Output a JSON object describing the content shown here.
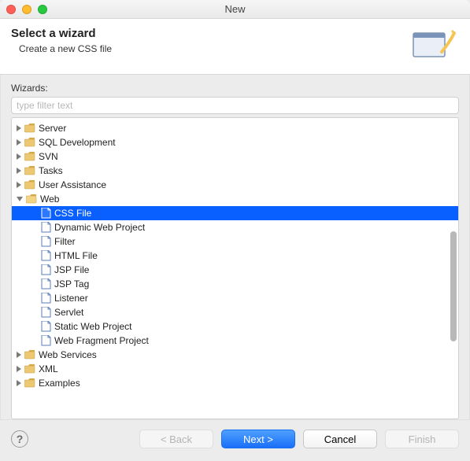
{
  "window": {
    "title": "New"
  },
  "header": {
    "title": "Select a wizard",
    "subtitle": "Create a new CSS file"
  },
  "wizards": {
    "label": "Wizards:",
    "filter_placeholder": "type filter text"
  },
  "tree": {
    "items": [
      {
        "label": "Server",
        "type": "folder",
        "state": "closed",
        "depth": 0
      },
      {
        "label": "SQL Development",
        "type": "folder",
        "state": "closed",
        "depth": 0
      },
      {
        "label": "SVN",
        "type": "folder",
        "state": "closed",
        "depth": 0
      },
      {
        "label": "Tasks",
        "type": "folder",
        "state": "closed",
        "depth": 0
      },
      {
        "label": "User Assistance",
        "type": "folder",
        "state": "closed",
        "depth": 0
      },
      {
        "label": "Web",
        "type": "folder",
        "state": "open",
        "depth": 0
      },
      {
        "label": "CSS File",
        "type": "item",
        "icon": "css",
        "depth": 1,
        "selected": true
      },
      {
        "label": "Dynamic Web Project",
        "type": "item",
        "icon": "project",
        "depth": 1
      },
      {
        "label": "Filter",
        "type": "item",
        "icon": "filter",
        "depth": 1
      },
      {
        "label": "HTML File",
        "type": "item",
        "icon": "html",
        "depth": 1
      },
      {
        "label": "JSP File",
        "type": "item",
        "icon": "jsp",
        "depth": 1
      },
      {
        "label": "JSP Tag",
        "type": "item",
        "icon": "jsptag",
        "depth": 1
      },
      {
        "label": "Listener",
        "type": "item",
        "icon": "listener",
        "depth": 1
      },
      {
        "label": "Servlet",
        "type": "item",
        "icon": "servlet",
        "depth": 1
      },
      {
        "label": "Static Web Project",
        "type": "item",
        "icon": "project",
        "depth": 1
      },
      {
        "label": "Web Fragment Project",
        "type": "item",
        "icon": "fragment",
        "depth": 1
      },
      {
        "label": "Web Services",
        "type": "folder",
        "state": "closed",
        "depth": 0
      },
      {
        "label": "XML",
        "type": "folder",
        "state": "closed",
        "depth": 0
      },
      {
        "label": "Examples",
        "type": "folder",
        "state": "closed",
        "depth": 0
      }
    ]
  },
  "buttons": {
    "back": "< Back",
    "next": "Next >",
    "cancel": "Cancel",
    "finish": "Finish"
  }
}
